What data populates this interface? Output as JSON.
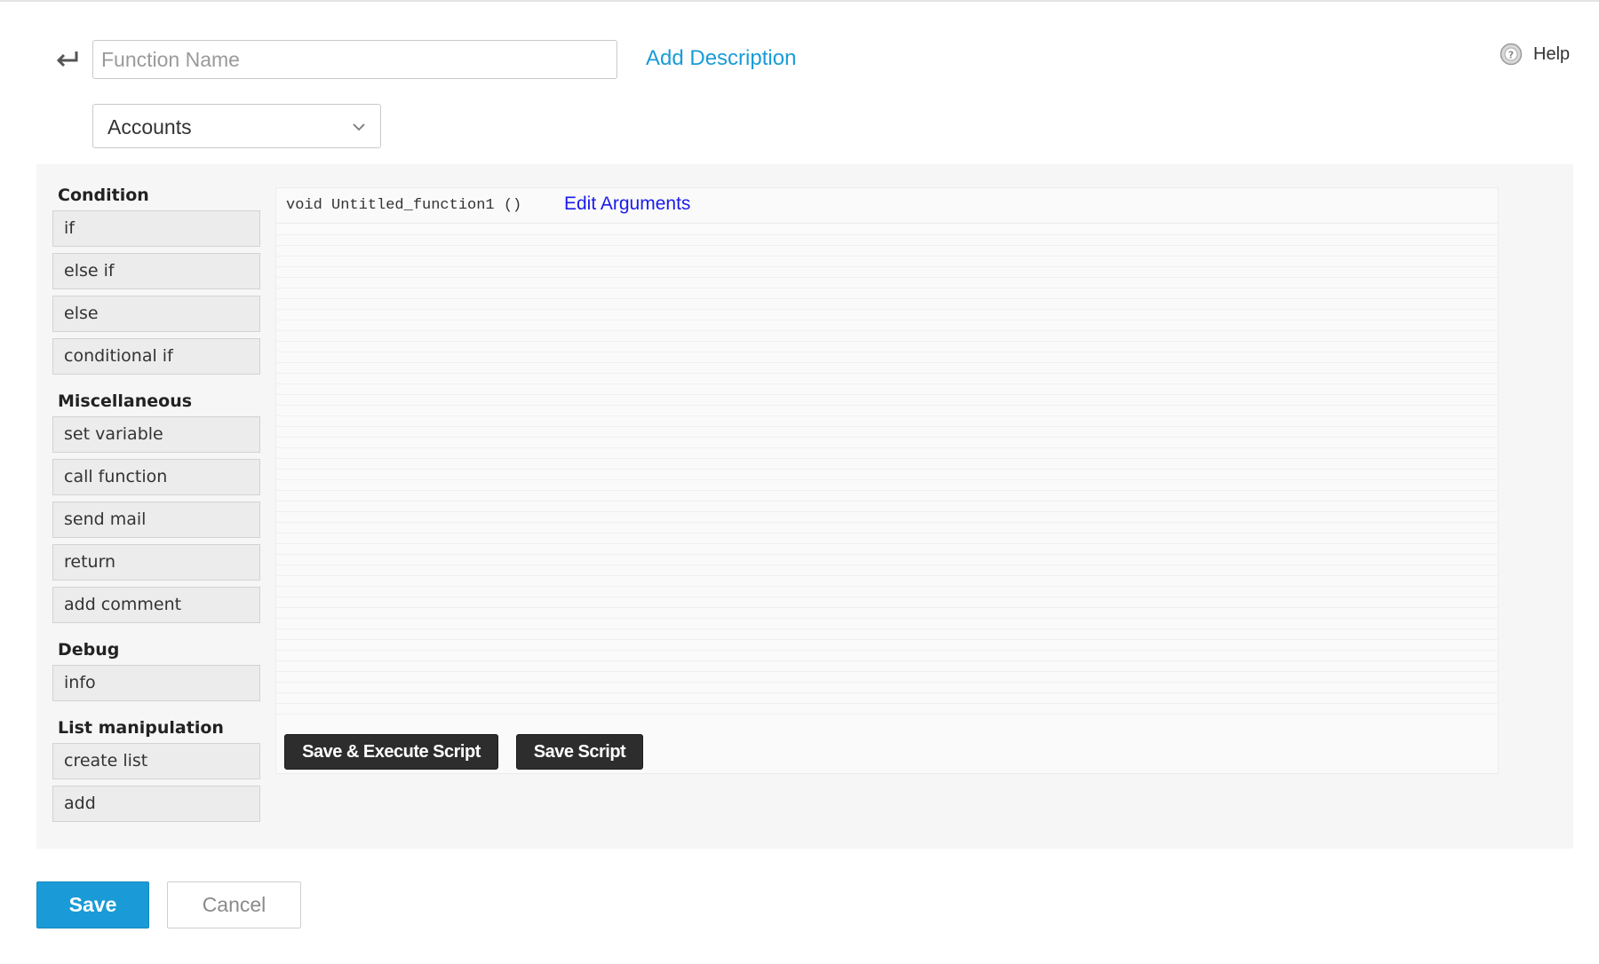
{
  "header": {
    "back_icon": "back-arrow-icon",
    "function_name_placeholder": "Function Name",
    "function_name_value": "",
    "add_description_label": "Add Description",
    "help_label": "Help",
    "help_icon": "help-circle-icon"
  },
  "module_select": {
    "selected": "Accounts",
    "icon": "chevron-down-icon"
  },
  "palette": {
    "sections": [
      {
        "heading": "Condition",
        "items": [
          "if",
          "else if",
          "else",
          "conditional if"
        ]
      },
      {
        "heading": "Miscellaneous",
        "items": [
          "set variable",
          "call function",
          "send mail",
          "return",
          "add comment"
        ]
      },
      {
        "heading": "Debug",
        "items": [
          "info"
        ]
      },
      {
        "heading": "List manipulation",
        "items": [
          "create list",
          "add"
        ]
      }
    ]
  },
  "editor": {
    "signature": "void Untitled_function1 ()",
    "edit_arguments_label": "Edit Arguments",
    "save_execute_label": "Save & Execute Script",
    "save_script_label": "Save Script"
  },
  "footer": {
    "save_label": "Save",
    "cancel_label": "Cancel",
    "primary_color": "#1a9bd7"
  }
}
